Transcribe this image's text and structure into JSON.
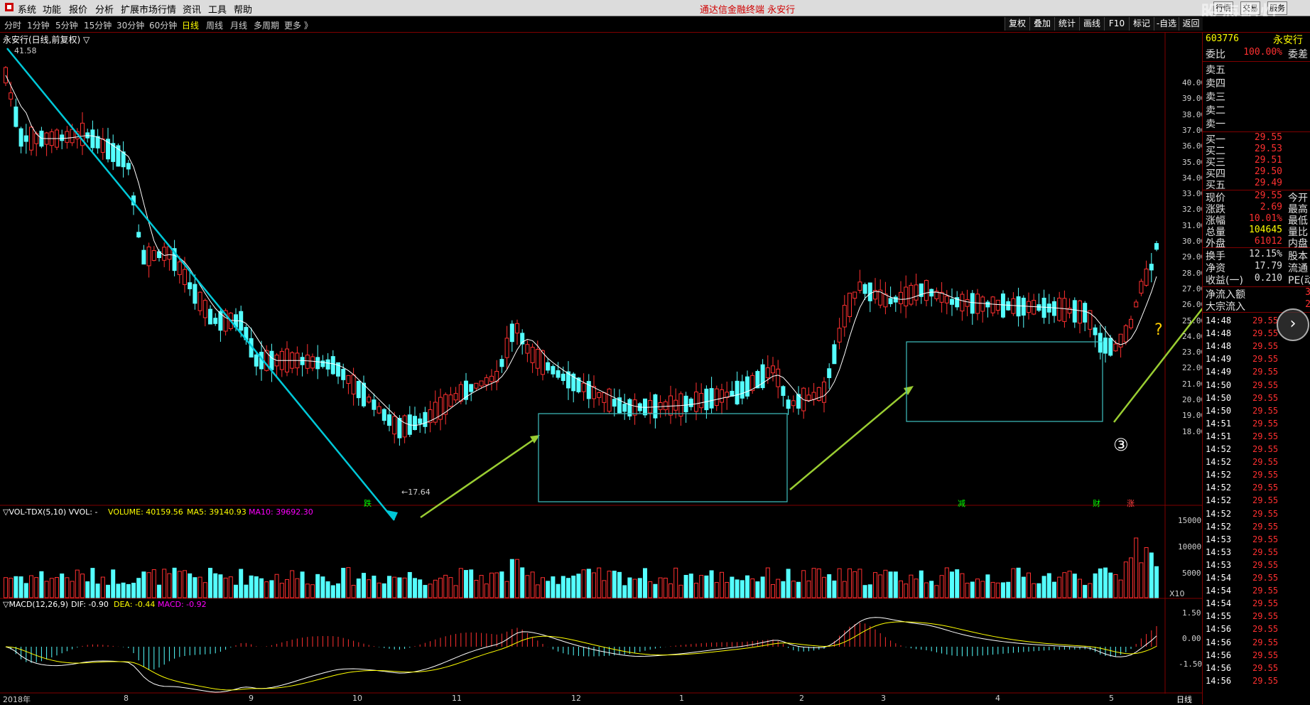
{
  "menu": {
    "items": [
      "系统",
      "功能",
      "报价",
      "分析",
      "扩展市场行情",
      "资讯",
      "工具",
      "帮助"
    ],
    "title": "通达信金融终端  永安行",
    "right_buttons": [
      "行情",
      "交易",
      "服务"
    ],
    "watermark": "股海明灯"
  },
  "periods": {
    "items": [
      "分时",
      "1分钟",
      "5分钟",
      "15分钟",
      "30分钟",
      "60分钟",
      "日线",
      "周线",
      "月线",
      "多周期",
      "更多 》"
    ],
    "active": "日线"
  },
  "tools": [
    "复权",
    "叠加",
    "统计",
    "画线",
    "F10",
    "标记",
    "-自选",
    "返回"
  ],
  "chart": {
    "stock_title": "永安行(日线,前复权) ▽",
    "high_label": "41.58",
    "low_label": "←17.64",
    "signals": [
      "跌",
      "减",
      "财",
      "涨"
    ],
    "annotations": [
      "③",
      "?"
    ],
    "price_ticks": [
      "40.00",
      "39.00",
      "38.00",
      "37.00",
      "36.00",
      "35.00",
      "34.00",
      "33.00",
      "32.00",
      "31.00",
      "30.00",
      "29.00",
      "28.00",
      "27.00",
      "26.00",
      "25.00",
      "24.00",
      "23.00",
      "22.00",
      "21.00",
      "20.00",
      "19.00",
      "18.00"
    ],
    "price_tick_values": [
      40,
      39,
      38,
      37,
      36,
      35,
      34,
      33,
      32,
      31,
      30,
      29,
      28,
      27,
      26,
      25,
      24,
      23,
      22,
      21,
      20,
      19,
      18
    ],
    "x_labels": [
      "2018年",
      "8",
      "9",
      "10",
      "11",
      "12",
      "1",
      "2",
      "3",
      "4",
      "5"
    ],
    "period_label": "日线",
    "vol_header": {
      "prefix": "▽VOL-TDX(5,10)  VVOL: -",
      "volume": "VOLUME: 40159.56",
      "ma5": "MA5: 39140.93",
      "ma10": "MA10: 39692.30",
      "unit": "X10",
      "ticks": [
        "15000",
        "10000",
        "5000"
      ]
    },
    "macd_header": {
      "prefix": "▽MACD(12,26,9)",
      "dif": "DIF: -0.90",
      "dea": "DEA: -0.44",
      "macd": "MACD: -0.92",
      "ticks": [
        "1.50",
        "0.00",
        "-1.50"
      ]
    }
  },
  "quote_panel": {
    "code": "603776",
    "name": "永安行",
    "weibi_label": "委比",
    "weibi_value": "100.00%",
    "weicha_label": "委差",
    "asks": [
      "卖五",
      "卖四",
      "卖三",
      "卖二",
      "卖一"
    ],
    "bids": [
      {
        "label": "买一",
        "price": "29.55"
      },
      {
        "label": "买二",
        "price": "29.53"
      },
      {
        "label": "买三",
        "price": "29.51"
      },
      {
        "label": "买四",
        "price": "29.50"
      },
      {
        "label": "买五",
        "price": "29.49"
      }
    ],
    "stats": [
      {
        "label": "现价",
        "value": "29.55",
        "right": "今开"
      },
      {
        "label": "涨跌",
        "value": "2.69",
        "right": "最高"
      },
      {
        "label": "涨幅",
        "value": "10.01%",
        "right": "最低"
      },
      {
        "label": "总量",
        "value": "104645",
        "right": "量比"
      },
      {
        "label": "外盘",
        "value": "61012",
        "right": "内盘"
      }
    ],
    "stats2": [
      {
        "label": "换手",
        "value": "12.15%",
        "right": "股本"
      },
      {
        "label": "净资",
        "value": "17.79",
        "right": "流通"
      },
      {
        "label": "收益(一)",
        "value": "0.210",
        "right": "PE(动"
      }
    ],
    "flows": [
      {
        "label": "净流入额",
        "value": "3"
      },
      {
        "label": "大宗流入",
        "value": "2"
      }
    ],
    "ticks": [
      {
        "t": "14:48",
        "p": "29.55"
      },
      {
        "t": "14:48",
        "p": "29.55"
      },
      {
        "t": "14:48",
        "p": "29.55"
      },
      {
        "t": "14:49",
        "p": "29.55"
      },
      {
        "t": "14:49",
        "p": "29.55"
      },
      {
        "t": "14:50",
        "p": "29.55"
      },
      {
        "t": "14:50",
        "p": "29.55"
      },
      {
        "t": "14:50",
        "p": "29.55"
      },
      {
        "t": "14:51",
        "p": "29.55"
      },
      {
        "t": "14:51",
        "p": "29.55"
      },
      {
        "t": "14:52",
        "p": "29.55"
      },
      {
        "t": "14:52",
        "p": "29.55"
      },
      {
        "t": "14:52",
        "p": "29.55"
      },
      {
        "t": "14:52",
        "p": "29.55"
      },
      {
        "t": "14:52",
        "p": "29.55"
      },
      {
        "t": "14:52",
        "p": "29.55"
      },
      {
        "t": "14:52",
        "p": "29.55"
      },
      {
        "t": "14:53",
        "p": "29.55"
      },
      {
        "t": "14:53",
        "p": "29.55"
      },
      {
        "t": "14:53",
        "p": "29.55"
      },
      {
        "t": "14:54",
        "p": "29.55"
      },
      {
        "t": "14:54",
        "p": "29.55"
      },
      {
        "t": "14:54",
        "p": "29.55"
      },
      {
        "t": "14:55",
        "p": "29.55"
      },
      {
        "t": "14:56",
        "p": "29.55"
      },
      {
        "t": "14:56",
        "p": "29.55"
      },
      {
        "t": "14:56",
        "p": "29.55"
      },
      {
        "t": "14:56",
        "p": "29.55"
      },
      {
        "t": "14:56",
        "p": "29.55"
      }
    ]
  },
  "colors": {
    "up": "#ff3030",
    "down": "#54ffff",
    "ma5": "#ffff00",
    "ma10": "#ff00ff",
    "trend": "#00c8d8",
    "arrow": "#9acd32",
    "box": "#40c0c0"
  }
}
